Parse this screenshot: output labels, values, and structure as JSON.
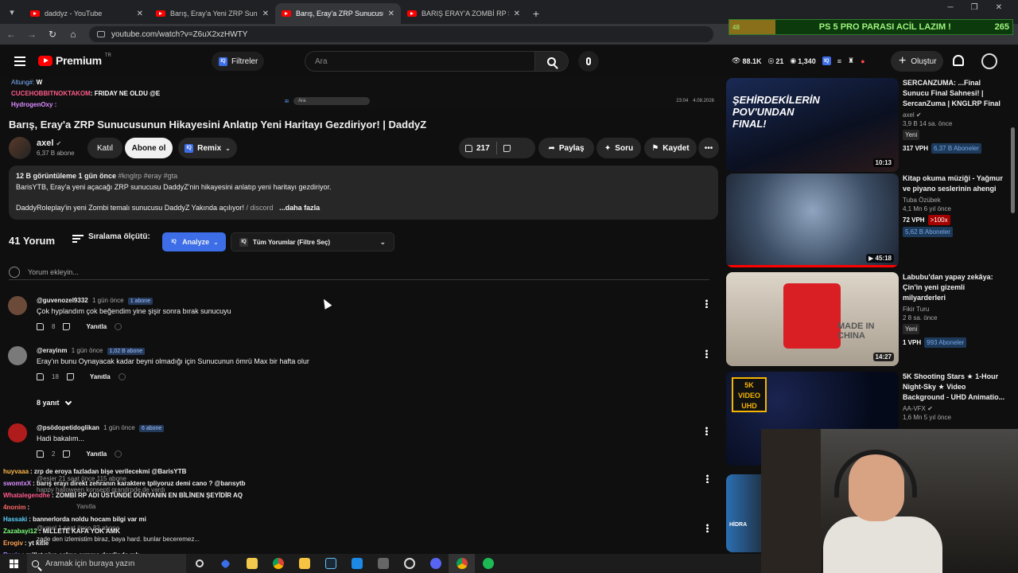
{
  "browser": {
    "tabs": [
      {
        "title": "daddyz - YouTube",
        "active": false
      },
      {
        "title": "Barış, Eray'a Yeni ZRP Sunucusu",
        "active": false
      },
      {
        "title": "Barış, Eray'a ZRP Sunucusunun",
        "active": true
      },
      {
        "title": "BARIŞ ERAY'A ZOMBİ RP SUNUCU",
        "active": false
      }
    ],
    "url": "youtube.com/watch?v=Z6uX2xzHWTY"
  },
  "overlay_banner": {
    "left": "48",
    "text": "PS 5 PRO PARASI ACİL LAZIM !",
    "number": "265"
  },
  "header": {
    "logo_text": "Premium",
    "logo_region": "TR",
    "filter_label": "Filtreler",
    "search_placeholder": "Ara",
    "stats": {
      "views": "88.1K",
      "comments": "21",
      "viewers": "1,340"
    },
    "create_label": "Oluştur"
  },
  "player_overlay": {
    "chat": [
      {
        "user": "Altung#:",
        "text": "W"
      },
      {
        "user": "CUCEHOBBITNOKTAKOM",
        "text": ": FRIDAY NE OLDU @E"
      },
      {
        "user": "HydrogenOxy :",
        "text": ""
      }
    ],
    "mini_search": "Ara",
    "mini_clock": "23:04",
    "mini_date": "4.08.2026"
  },
  "video": {
    "title": "Barış, Eray'a ZRP Sunucusunun Hikayesini Anlatıp Yeni Haritayı Gezdiriyor! | DaddyZ",
    "channel_name": "axel",
    "channel_subs": "6,37 B abone",
    "join_label": "Katıl",
    "subscribe_label": "Abone ol",
    "remix_label": "Remix",
    "likes": "217",
    "share_label": "Paylaş",
    "ask_label": "Soru",
    "save_label": "Kaydet"
  },
  "description": {
    "meta": "12 B görüntüleme  1 gün önce",
    "tags": "#knglrp #eray #gta",
    "line1": "BarisYTB, Eray'a yeni açacağı ZRP sunucusu DaddyZ'nin hikayesini anlatıp yeni haritayı gezdiriyor.",
    "line2": "DaddyRoleplay'in yeni Zombi temalı sunucusu DaddyZ Yakında açılıyor!",
    "link": "/ discord",
    "more": "...daha fazla"
  },
  "comments_section": {
    "count_label": "41 Yorum",
    "sort_label": "Sıralama ölçütü:",
    "analyze_label": "Analyze",
    "filter_label": "Tüm Yorumlar (Filtre Seç)",
    "add_placeholder": "Yorum ekleyin...",
    "reply_label": "Yanıtla",
    "comments": [
      {
        "user": "@guvenozel9332",
        "ago": "1 gün önce",
        "badge": "1 abone",
        "text": "Çok hyplandım çok beğendim yine şişir sonra bırak sunucuyu",
        "likes": "8"
      },
      {
        "user": "@erayinm",
        "ago": "1 gün önce",
        "badge": "1,02 B abone",
        "text": "Eray'ın bunu Oynayacak kadar beyni olmadığı için Sunucunun ömrü Max bir hafta olur",
        "likes": "18"
      },
      {
        "user": "@psödopetidoglikan",
        "ago": "1 gün önce",
        "badge": "6 abone",
        "text": "Hadi bakalım...",
        "likes": "2"
      }
    ],
    "replies_toggle": "8 yanıt"
  },
  "live_chat": [
    {
      "user": "huyvaaa",
      "text": ": zrp de eroya fazladan bişe verilecekmi @BarisYTB",
      "color": "#ffb84a"
    },
    {
      "user": "swomtxX",
      "text": ": barış erayı direkt zehranın karaktere tpliyoruz demi cano ? @barısytb",
      "color": "#d98cff"
    },
    {
      "user": "Whatalegendhe",
      "text": ": ZOMBİ RP ADI ÜSTÜNDE DÜNYANIN EN BİLİNEN ŞEYİDİR AQ",
      "color": "#ff5a8a"
    },
    {
      "user": "4nonim",
      "text": ":",
      "color": "#ff6868"
    },
    {
      "user": "Hassaki",
      "text": ": bannerlorda noldu hocam bilgi var mi",
      "color": "#5ad2ff"
    },
    {
      "user": "Zazabayi12",
      "text": ": MİLLETE KAFA YOK AMK",
      "color": "#7cff7c"
    },
    {
      "user": "Erogiv",
      "text": ": yt kitle",
      "color": "#ff9f50"
    },
    {
      "user": "Roxis",
      "text": ": millet niye çalma çırpma derdinde mk",
      "color": "#a98bff"
    }
  ],
  "ghost_comments": [
    {
      "text": "@esjer  21 saat önce  115 abone"
    },
    {
      "text": "happy halloween konsepti grandrpde de vardı"
    },
    {
      "text": "Yanıtla"
    },
    {
      "text": "@ymel  1 saat önce  83 abone"
    },
    {
      "text": "zade den izlemistim biraz, baya hard. bunlar beceremez..."
    }
  ],
  "taskbar": {
    "search_placeholder": "Aramak için buraya yazın"
  },
  "recommendations": [
    {
      "title": "SERCANZUMA: ...Final Sunucu Final Sahnesi! | SercanZuma | KNGLRP Final",
      "channel": "axel",
      "meta": "3,9 B  14 sa. önce",
      "tag": "Yeni",
      "vph": "317 VPH",
      "subs": "6,37 B Aboneler",
      "duration": "10:13",
      "thumb_text": "ŞEHİRDEKİLERİN POV'UNDAN FINAL!",
      "color": "#1a2a55"
    },
    {
      "title": "Kitap okuma müziği - Yağmur ve piyano seslerinin ahengi",
      "channel": "Tuba Özübek",
      "meta": "4,1 Mn  6 yıl önce",
      "vph": "72 VPH",
      "ratio": ">100x",
      "subs": "5,62 B Aboneler",
      "duration": "45:18",
      "color": "#3d4f66"
    },
    {
      "title": "Labubu'dan yapay zekâya: Çin'in yeni gizemli milyarderleri",
      "channel": "Fikir Turu",
      "meta": "2  8 sa. önce",
      "tag": "Yeni",
      "vph": "1 VPH",
      "subs": "993 Aboneler",
      "duration": "14:27",
      "thumb_text": "MADE IN CHINA",
      "color": "#bdb5a8"
    },
    {
      "title": "5K Shooting Stars ★ 1-Hour Night-Sky ★ Video Background - UHD Animatio...",
      "channel": "AA-VFX",
      "meta": "1,6 Mn  5 yıl önce",
      "thumb_text": "5K VIDEO UHD",
      "color": "#050a1a"
    },
    {
      "title": "",
      "thumb_text": "HİDRA",
      "color": "#1a1a1a"
    }
  ]
}
